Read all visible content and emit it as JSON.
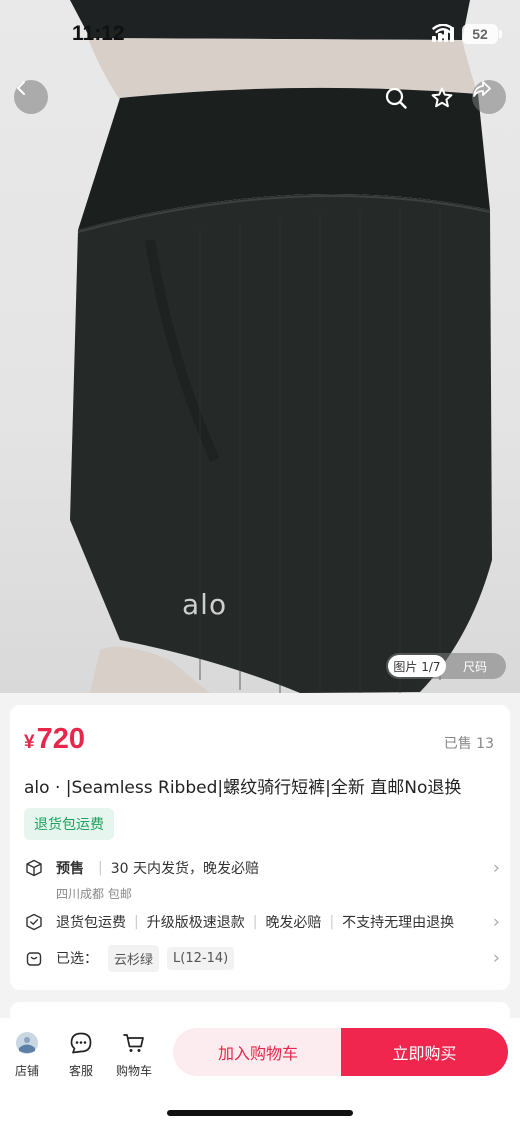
{
  "status": {
    "time": "11:12",
    "battery": "52"
  },
  "gallery": {
    "brand_logo": "alo",
    "tabs": [
      {
        "label": "图片 1/7"
      },
      {
        "label": "尺码"
      }
    ]
  },
  "product": {
    "currency": "¥",
    "price": "720",
    "sold": "已售 13",
    "title": "alo · |Seamless Ribbed|螺纹骑行短裤|全新 直邮No退换",
    "tag": "退货包运费"
  },
  "rows": {
    "presale_label": "预售",
    "presale_text": "30 天内发货，晚发必赔",
    "location": "四川成都 包邮",
    "services": [
      "退货包运费",
      "升级版极速退款",
      "晚发必赔",
      "不支持无理由退换"
    ],
    "selected_label": "已选：",
    "selected_color": "云杉绿",
    "selected_size": "L(12-14)"
  },
  "bottom": {
    "store": "店铺",
    "service": "客服",
    "cart": "购物车",
    "add_to_cart": "加入购物车",
    "buy_now": "立即购买"
  },
  "colors": {
    "accent": "#f0264e",
    "price": "#e8254a",
    "tag_green": "#20a060"
  }
}
